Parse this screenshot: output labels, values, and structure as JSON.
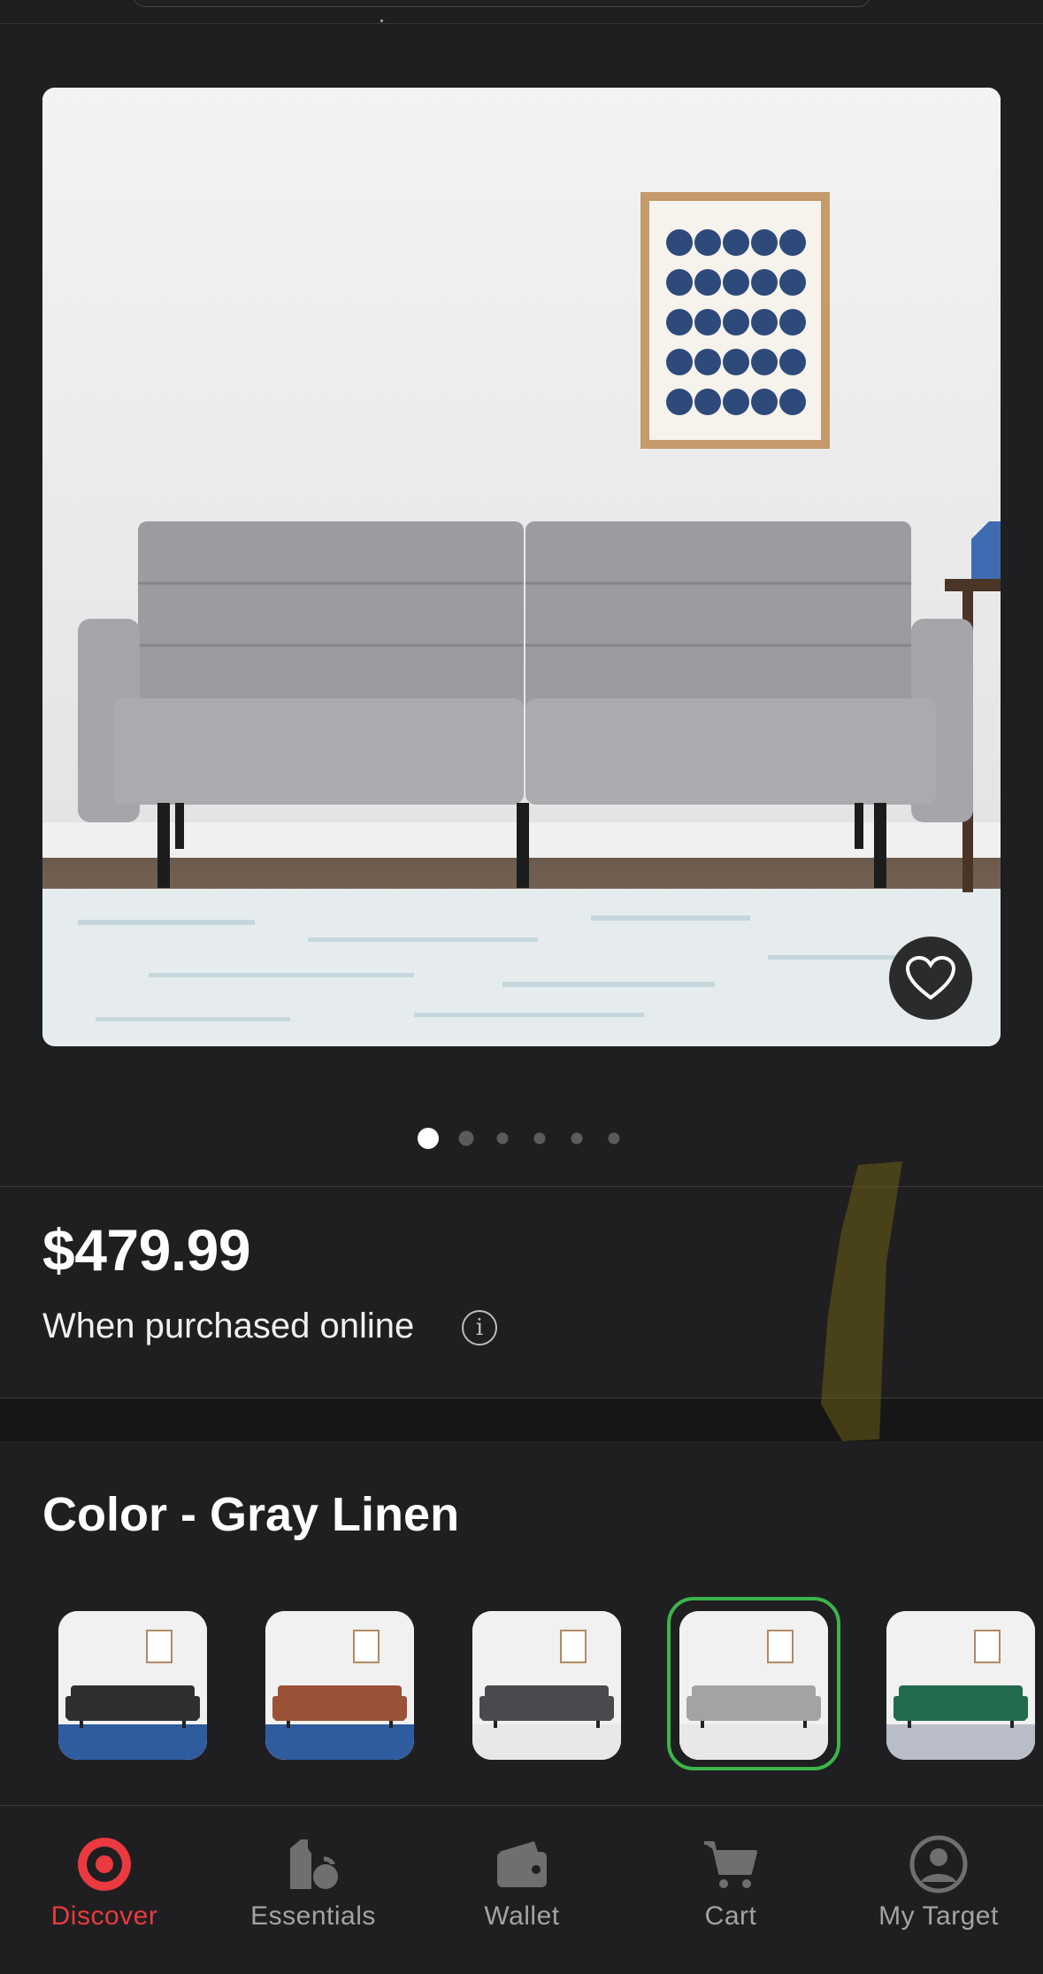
{
  "product": {
    "price": "$479.99",
    "price_note": "When purchased online",
    "color_label": "Color - Gray Linen",
    "image_count": 6,
    "active_image": 1
  },
  "swatches": [
    {
      "name": "Black",
      "color": "#2f2f31",
      "rug": "#2f5b9f",
      "selected": false
    },
    {
      "name": "Brown",
      "color": "#9b5236",
      "rug": "#2f5b9f",
      "selected": false
    },
    {
      "name": "Charcoal",
      "color": "#4a4a4e",
      "rug": "#e8e8e8",
      "selected": false
    },
    {
      "name": "Gray Linen",
      "color": "#a3a3a6",
      "rug": "#e8e8e8",
      "selected": true
    },
    {
      "name": "Green",
      "color": "#226b4d",
      "rug": "#b9bdc8",
      "selected": false
    }
  ],
  "nav": {
    "items": [
      {
        "label": "Discover",
        "icon": "target-icon",
        "active": true
      },
      {
        "label": "Essentials",
        "icon": "essentials-icon",
        "active": false
      },
      {
        "label": "Wallet",
        "icon": "wallet-icon",
        "active": false
      },
      {
        "label": "Cart",
        "icon": "cart-icon",
        "active": false
      },
      {
        "label": "My Target",
        "icon": "account-icon",
        "active": false
      }
    ]
  },
  "colors": {
    "background": "#1f1f21",
    "accent_red": "#ea3a3f",
    "selected_ring": "#3ab54a",
    "muted_text": "#a3a3a6"
  }
}
